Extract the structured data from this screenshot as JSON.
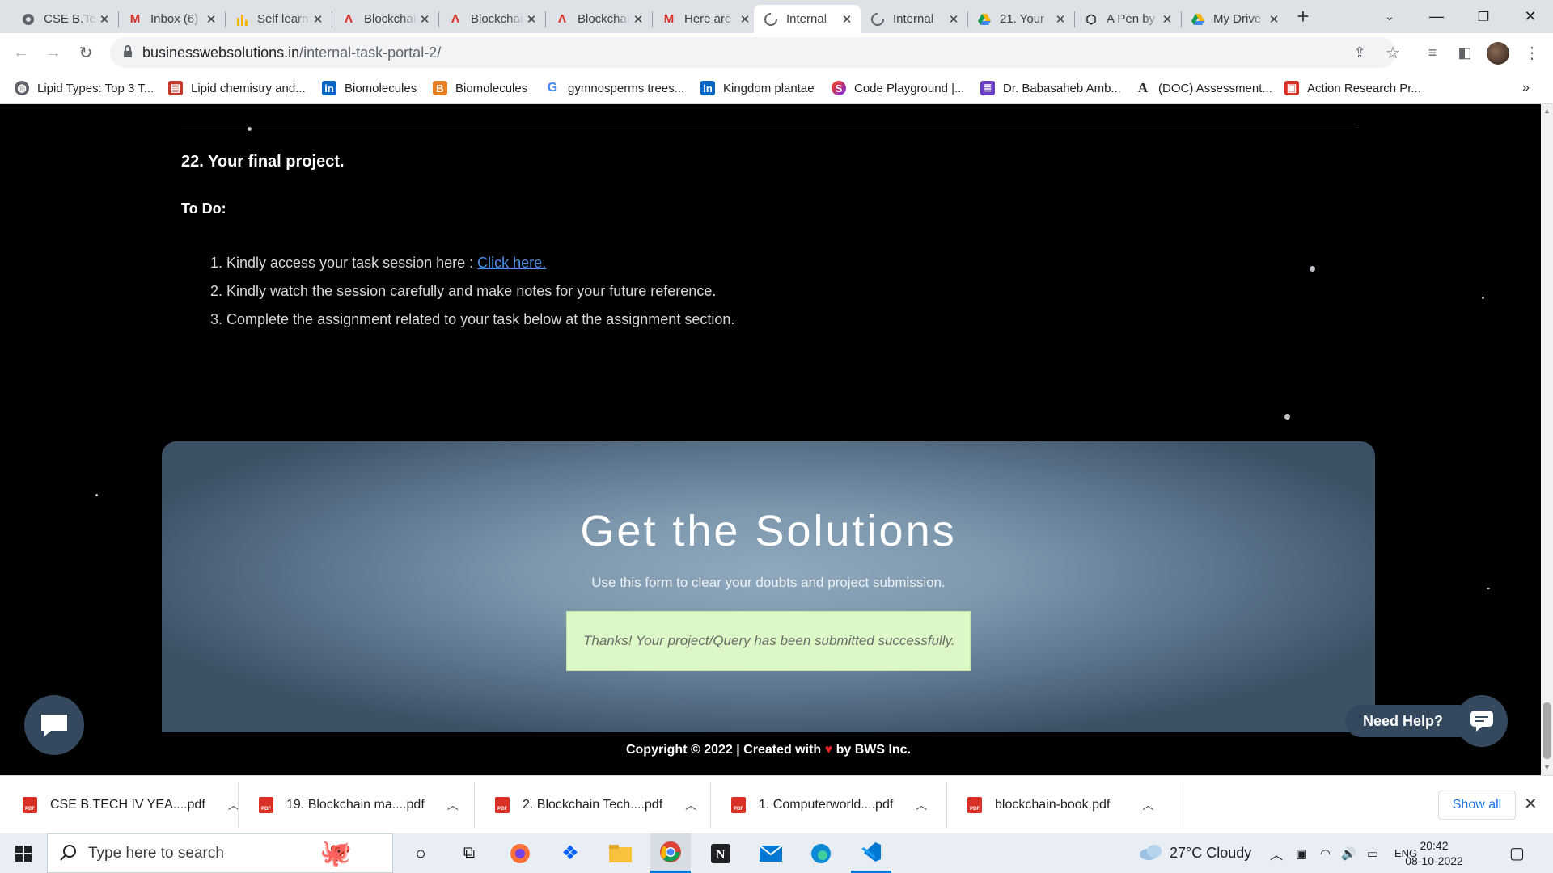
{
  "browser": {
    "tabs": [
      {
        "title": "CSE B.Tech",
        "icon": "chrome-icon",
        "active": false
      },
      {
        "title": "Inbox (6)",
        "icon": "gmail-icon",
        "active": false
      },
      {
        "title": "Self learning",
        "icon": "sheets-icon",
        "active": false
      },
      {
        "title": "Blockchain",
        "icon": "adobe-icon",
        "active": false
      },
      {
        "title": "Blockchain",
        "icon": "adobe-icon",
        "active": false
      },
      {
        "title": "Blockchain",
        "icon": "adobe-icon",
        "active": false
      },
      {
        "title": "Here are",
        "icon": "gmail-icon",
        "active": false
      },
      {
        "title": "Internal",
        "icon": "loading-icon",
        "active": true
      },
      {
        "title": "Internal",
        "icon": "loading-icon",
        "active": false
      },
      {
        "title": "21. Your",
        "icon": "drive-icon",
        "active": false
      },
      {
        "title": "A Pen by",
        "icon": "codepen-icon",
        "active": false
      },
      {
        "title": "My Drive",
        "icon": "drive-icon",
        "active": false
      }
    ],
    "url_host": "businesswebsolutions.in",
    "url_path": "/internal-task-portal-2/",
    "bookmarks": [
      {
        "label": "Lipid Types: Top 3 T...",
        "icon": "globe-icon",
        "color": "#5f6368"
      },
      {
        "label": "Lipid chemistry and...",
        "icon": "document-icon",
        "color": "#c0392b"
      },
      {
        "label": "Biomolecules",
        "icon": "linkedin-icon",
        "color": "#0a66c2"
      },
      {
        "label": "Biomolecules",
        "icon": "byjus-icon",
        "color": "#e67e22"
      },
      {
        "label": "gymnosperms trees...",
        "icon": "google-icon",
        "color": "#4285f4"
      },
      {
        "label": "Kingdom plantae",
        "icon": "linkedin-icon",
        "color": "#0a66c2"
      },
      {
        "label": "Code Playground |...",
        "icon": "playground-icon",
        "color": "#7b2ff7"
      },
      {
        "label": "Dr. Babasaheb Amb...",
        "icon": "list-icon",
        "color": "#6a3fc1"
      },
      {
        "label": "(DOC) Assessment...",
        "icon": "academia-icon",
        "color": "#202124"
      },
      {
        "label": "Action Research Pr...",
        "icon": "slideshare-icon",
        "color": "#d93025"
      }
    ]
  },
  "page": {
    "section_title": "22. Your final project.",
    "todo_label": "To Do:",
    "todo_items": [
      {
        "text": "1. Kindly access your task session here : ",
        "link": "Click here."
      },
      {
        "text": "2. Kindly watch the session carefully and make notes for your future reference."
      },
      {
        "text": "3. Complete the assignment related to your task below at the assignment section."
      }
    ],
    "solutions": {
      "title": "Get the Solutions",
      "subtitle": "Use this form to clear your doubts and project submission.",
      "success_message": "Thanks! Your project/Query has been submitted successfully."
    },
    "copyright_prefix": "Copyright ©  2022 |  Created with ",
    "copyright_suffix": " by BWS Inc.",
    "need_help": "Need Help?"
  },
  "downloads": {
    "items": [
      {
        "name": "CSE B.TECH IV YEA....pdf"
      },
      {
        "name": "19. Blockchain ma....pdf"
      },
      {
        "name": "2. Blockchain Tech....pdf"
      },
      {
        "name": "1. Computerworld....pdf"
      },
      {
        "name": "blockchain-book.pdf"
      }
    ],
    "show_all": "Show all"
  },
  "taskbar": {
    "search_placeholder": "Type here to search",
    "weather": "27°C  Cloudy",
    "language": "ENG",
    "time": "20:42",
    "date": "08-10-2022"
  }
}
